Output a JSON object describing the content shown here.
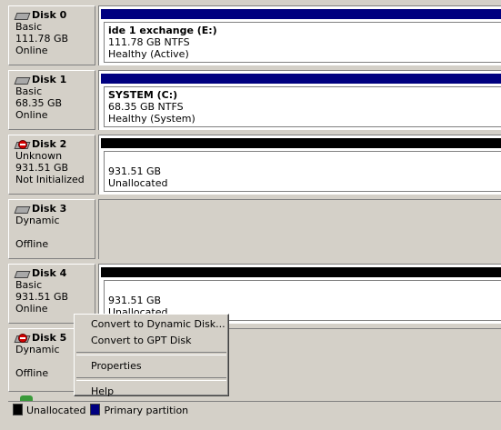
{
  "disks": [
    {
      "name": "Disk 0",
      "type": "Basic",
      "size": "111.78 GB",
      "status": "Online",
      "icon": "disk-icon",
      "partition": {
        "bar": "primary",
        "label": "ide 1 exchange  (E:)",
        "size": "111.78 GB NTFS",
        "status": "Healthy (Active)"
      }
    },
    {
      "name": "Disk 1",
      "type": "Basic",
      "size": "68.35 GB",
      "status": "Online",
      "icon": "disk-icon",
      "partition": {
        "bar": "primary",
        "label": "SYSTEM  (C:)",
        "size": "68.35 GB NTFS",
        "status": "Healthy (System)"
      }
    },
    {
      "name": "Disk 2",
      "type": "Unknown",
      "size": "931.51 GB",
      "status": "Not Initialized",
      "icon": "disk-error-icon",
      "partition": {
        "bar": "unallocated",
        "label": "",
        "size": "931.51 GB",
        "status": "Unallocated"
      }
    },
    {
      "name": "Disk 3",
      "type": "Dynamic",
      "size": "",
      "status": "Offline",
      "icon": "disk-icon"
    },
    {
      "name": "Disk 4",
      "type": "Basic",
      "size": "931.51 GB",
      "status": "Online",
      "icon": "disk-icon",
      "partition": {
        "bar": "unallocated",
        "label": "",
        "size": "931.51 GB",
        "status": "Unallocated"
      }
    },
    {
      "name": "Disk 5",
      "type": "Dynamic",
      "size": "",
      "status": "Offline",
      "icon": "disk-error-icon"
    }
  ],
  "context_menu": {
    "items": [
      "Convert to Dynamic Disk...",
      "Convert to GPT Disk",
      "Properties",
      "Help"
    ]
  },
  "legend": {
    "unallocated": "Unallocated",
    "primary": "Primary partition",
    "unallocated_color": "#000000",
    "primary_color": "#000080"
  }
}
